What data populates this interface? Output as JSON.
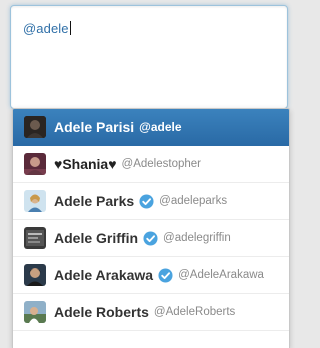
{
  "compose": {
    "text": "@adele"
  },
  "suggestions": [
    {
      "name": "Adele Parisi",
      "handle": "@adele",
      "verified": false,
      "selected": true
    },
    {
      "name": "♥Shania♥",
      "handle": "@Adelestopher",
      "verified": false,
      "selected": false
    },
    {
      "name": "Adele Parks",
      "handle": "@adeleparks",
      "verified": true,
      "selected": false
    },
    {
      "name": "Adele Griffin",
      "handle": "@adelegriffin",
      "verified": true,
      "selected": false
    },
    {
      "name": "Adele Arakawa",
      "handle": "@AdeleArakawa",
      "verified": true,
      "selected": false
    },
    {
      "name": "Adele Roberts",
      "handle": "@AdeleRoberts",
      "verified": false,
      "selected": false
    }
  ],
  "icons": {
    "verified": "verified-badge-icon"
  },
  "colors": {
    "selected_bg": "#2f74b0",
    "verified": "#4aa3df",
    "mention_text": "#3070a8"
  }
}
